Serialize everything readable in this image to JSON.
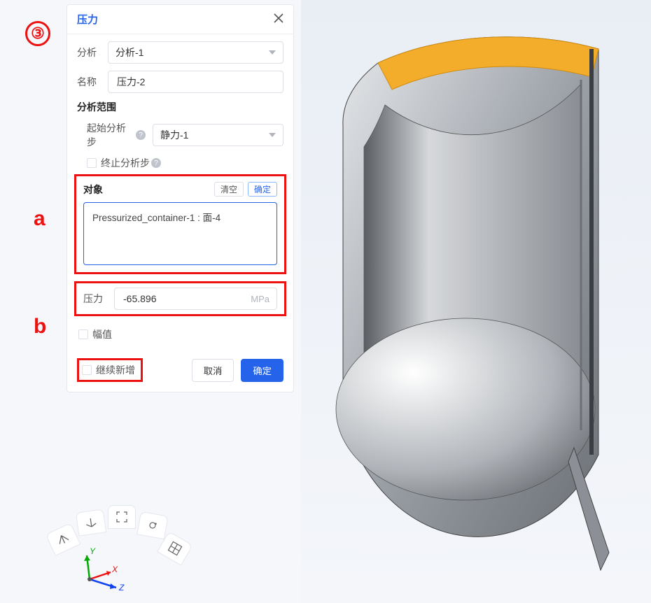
{
  "annotations": {
    "circle3": "③",
    "a": "a",
    "b": "b"
  },
  "panel": {
    "title": "压力",
    "analysis_label": "分析",
    "analysis_value": "分析-1",
    "name_label": "名称",
    "name_value": "压力-2",
    "range_title": "分析范围",
    "start_step_label": "起始分析步",
    "start_step_value": "静力-1",
    "end_step_label": "终止分析步",
    "object_title": "对象",
    "clear_btn": "清空",
    "confirm_btn": "确定",
    "object_item": "Pressurized_container-1 : 面-4",
    "pressure_label": "压力",
    "pressure_value": "-65.896",
    "pressure_unit": "MPa",
    "amplitude_label": "幅值",
    "continue_label": "继续新增",
    "cancel_btn": "取消",
    "ok_btn": "确定"
  },
  "nav": {
    "axes": [
      "X",
      "Y",
      "Z"
    ]
  }
}
